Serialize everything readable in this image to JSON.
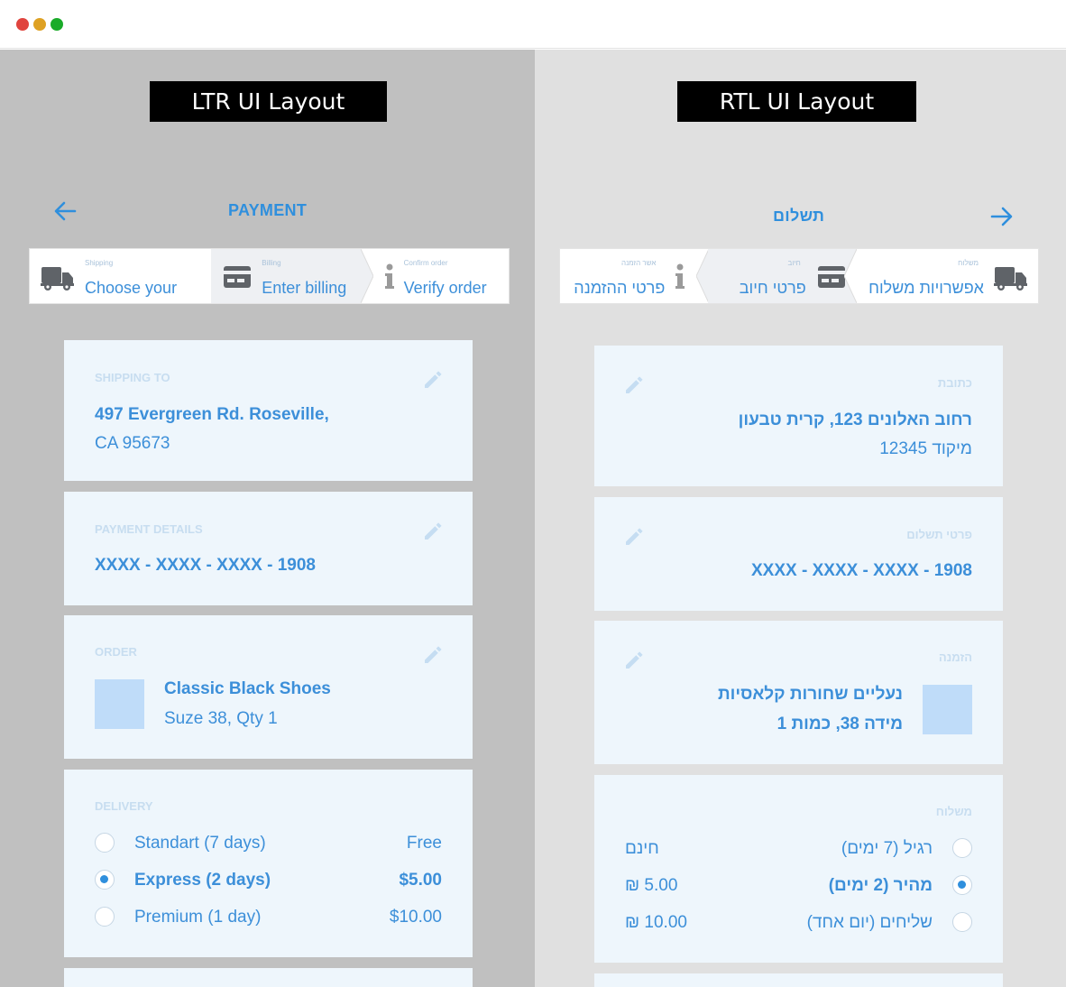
{
  "window": {
    "controls": {
      "close_color": "#e0443e",
      "minimize_color": "#dea123",
      "maximize_color": "#1aab29"
    }
  },
  "colors": {
    "accent": "#2f8fdd",
    "card_bg": "#eef6fc",
    "left_panel_bg": "#c0c0c0",
    "right_panel_bg": "#e0e0e0"
  },
  "ltr": {
    "layout_label": "LTR UI Layout",
    "header": {
      "title": "PAYMENT",
      "back_icon": "arrow-left-icon"
    },
    "steps": [
      {
        "small": "Shipping",
        "text": "Choose your",
        "icon": "truck-icon"
      },
      {
        "small": "Billing",
        "text": "Enter billing",
        "icon": "credit-card-icon"
      },
      {
        "small": "Confirm order",
        "text": "Verify order",
        "icon": "info-icon"
      }
    ],
    "shipping": {
      "label": "SHIPPING TO",
      "line1": "497 Evergreen Rd. Roseville,",
      "line2": "CA 95673"
    },
    "payment": {
      "label": "PAYMENT DETAILS",
      "card": "XXXX - XXXX - XXXX - 1908"
    },
    "order": {
      "label": "ORDER",
      "name": "Classic Black Shoes",
      "details": "Suze 38, Qty 1"
    },
    "delivery": {
      "label": "DELIVERY",
      "options": [
        {
          "name": "Standart (7 days)",
          "price": "Free",
          "checked": false
        },
        {
          "name": "Express (2 days)",
          "price": "$5.00",
          "checked": true
        },
        {
          "name": "Premium (1 day)",
          "price": "$10.00",
          "checked": false
        }
      ]
    }
  },
  "rtl": {
    "layout_label": "RTL UI Layout",
    "header": {
      "title": "תשלום",
      "back_icon": "arrow-right-icon"
    },
    "steps": [
      {
        "small": "משלוח",
        "text": "אפשרויות משלוח",
        "icon": "truck-icon"
      },
      {
        "small": "חיוב",
        "text": "פרטי חיוב",
        "icon": "credit-card-icon"
      },
      {
        "small": "אשר הזמנה",
        "text": "פרטי ההזמנה",
        "icon": "info-icon"
      }
    ],
    "shipping": {
      "label": "כתובת",
      "line1": "רחוב האלונים 123, קרית טבעון",
      "line2": "מיקוד 12345"
    },
    "payment": {
      "label": "פרטי תשלום",
      "card": "XXXX - XXXX - XXXX - 1908"
    },
    "order": {
      "label": "הזמנה",
      "name": "נעליים שחורות קלאסיות",
      "details": "מידה 38, כמות 1"
    },
    "delivery": {
      "label": "משלוח",
      "options": [
        {
          "name": "רגיל (7 ימים)",
          "price": "חינם",
          "checked": false
        },
        {
          "name": "מהיר (2 ימים)",
          "price": "5.00 ₪",
          "checked": true
        },
        {
          "name": "שליחים (יום אחד)",
          "price": "10.00 ₪",
          "checked": false
        }
      ]
    }
  }
}
